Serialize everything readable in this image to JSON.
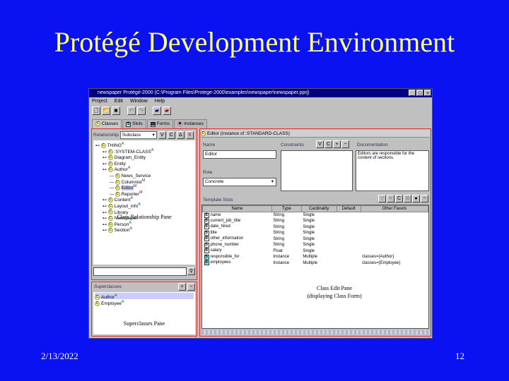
{
  "slide": {
    "title": "Protégé Development Environment",
    "date": "2/13/2022",
    "page": "12"
  },
  "window": {
    "title": "newspaper  Protégé-2000    (C:\\Program Files\\Protege-2000\\examples\\newspaper\\newspaper.pprj)",
    "menu": [
      "Project",
      "Edit",
      "Window",
      "Help"
    ],
    "tabs": [
      "Classes",
      "Slots",
      "Forms",
      "Instances"
    ]
  },
  "left": {
    "relationship_label": "Relationship",
    "relationship_value": "Subclass",
    "buttons": [
      "V",
      "C",
      "∆",
      "X"
    ],
    "tree": [
      {
        "label": "THING",
        "depth": 0,
        "badge": "A"
      },
      {
        "label": ":SYSTEM-CLASS",
        "depth": 1,
        "badge": "A"
      },
      {
        "label": "Diagram_Entity",
        "depth": 1,
        "badge": ""
      },
      {
        "label": "Entity",
        "depth": 1,
        "badge": ""
      },
      {
        "label": "Author",
        "depth": 1,
        "badge": "A"
      },
      {
        "label": "News_Service",
        "depth": 2,
        "badge": ""
      },
      {
        "label": "Columnist",
        "depth": 2,
        "badge": "M"
      },
      {
        "label": "Editor",
        "depth": 2,
        "badge": "M",
        "selected": true
      },
      {
        "label": "Reporter",
        "depth": 2,
        "badge": "M"
      },
      {
        "label": "Content",
        "depth": 1,
        "badge": "A"
      },
      {
        "label": "Layout_info",
        "depth": 1,
        "badge": "A"
      },
      {
        "label": "Library",
        "depth": 1,
        "badge": ""
      },
      {
        "label": "Newspaper",
        "depth": 1,
        "badge": ""
      },
      {
        "label": "Person",
        "depth": 1,
        "badge": "A"
      },
      {
        "label": "Section",
        "depth": 1,
        "badge": "A"
      }
    ],
    "caption": "Class Relationship Pane",
    "superclasses_label": "Superclasses",
    "superclasses": [
      "Author",
      "Employee"
    ],
    "superclasses_caption": "Superclasses Pane"
  },
  "right": {
    "header": "Editor  (instance of :STANDARD-CLASS)",
    "name_label": "Name",
    "name_value": "Editor",
    "role_label": "Role",
    "role_value": "Concrete",
    "constraints_label": "Constraints",
    "documentation_label": "Documentation",
    "documentation_value": "Editors are responsible for the content of sections.",
    "template_slots_label": "Template Slots",
    "columns": [
      "Name",
      "Type",
      "Cardinality",
      "Default",
      "Other Facets"
    ],
    "slots": [
      [
        "name",
        "String",
        "Single",
        "",
        ""
      ],
      [
        "current_job_title",
        "String",
        "Single",
        "",
        ""
      ],
      [
        "date_hired",
        "String",
        "Single",
        "",
        ""
      ],
      [
        "title",
        "String",
        "Single",
        "",
        ""
      ],
      [
        "other_information",
        "String",
        "Single",
        "",
        ""
      ],
      [
        "phone_number",
        "String",
        "Single",
        "",
        ""
      ],
      [
        "salary",
        "Float",
        "Single",
        "",
        ""
      ],
      [
        "responsible_for",
        "Instance",
        "Multiple",
        "",
        "classes={Author}"
      ],
      [
        "employees",
        "Instance",
        "Multiple",
        "",
        "classes={Employee}"
      ]
    ],
    "caption": "Class Edit Pane\n(displaying Class Form)"
  }
}
